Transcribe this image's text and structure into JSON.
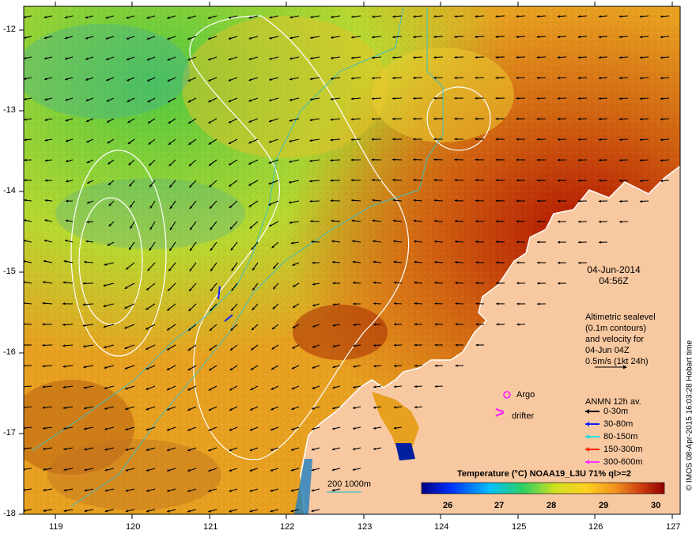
{
  "map": {
    "x_ticks": [
      "119",
      "120",
      "121",
      "122",
      "123",
      "124",
      "125",
      "126",
      "127"
    ],
    "y_ticks": [
      "-12",
      "-13",
      "-14",
      "-15",
      "-16",
      "-17",
      "-18"
    ],
    "date": "04-Jun-2014",
    "time": "04:56Z",
    "altimetry_note": [
      "Altimetric sealevel",
      "(0.1m contours)",
      "and velocity for",
      "04-Jun 04Z",
      "0.5m/s (1kt 24h)"
    ],
    "argo_label": "Argo",
    "drifter_label": "drifter",
    "drifter_glyph": ">",
    "anmn_title": "ANMN 12h av.",
    "anmn_legend": [
      {
        "label": "0-30m",
        "color": "#000000"
      },
      {
        "label": "30-80m",
        "color": "#1020ff"
      },
      {
        "label": "80-150m",
        "color": "#20e0e0"
      },
      {
        "label": "150-300m",
        "color": "#ff2000"
      },
      {
        "label": "300-600m",
        "color": "#ff30ff"
      }
    ],
    "depth_contour_label": "200  1000m",
    "colorbar_title": "Temperature (°C) NOAA19_L3U 71% ql>=2",
    "colorbar_ticks": [
      "26",
      "27",
      "28",
      "29",
      "30"
    ],
    "credit": "© IMOS 08-Apr-2015 16:03:28 Hobart time",
    "colors": {
      "land": "#f8c8a0",
      "contour": "#ffffff",
      "bathy": "#40c0c0",
      "argo": "#ff20ff"
    }
  }
}
